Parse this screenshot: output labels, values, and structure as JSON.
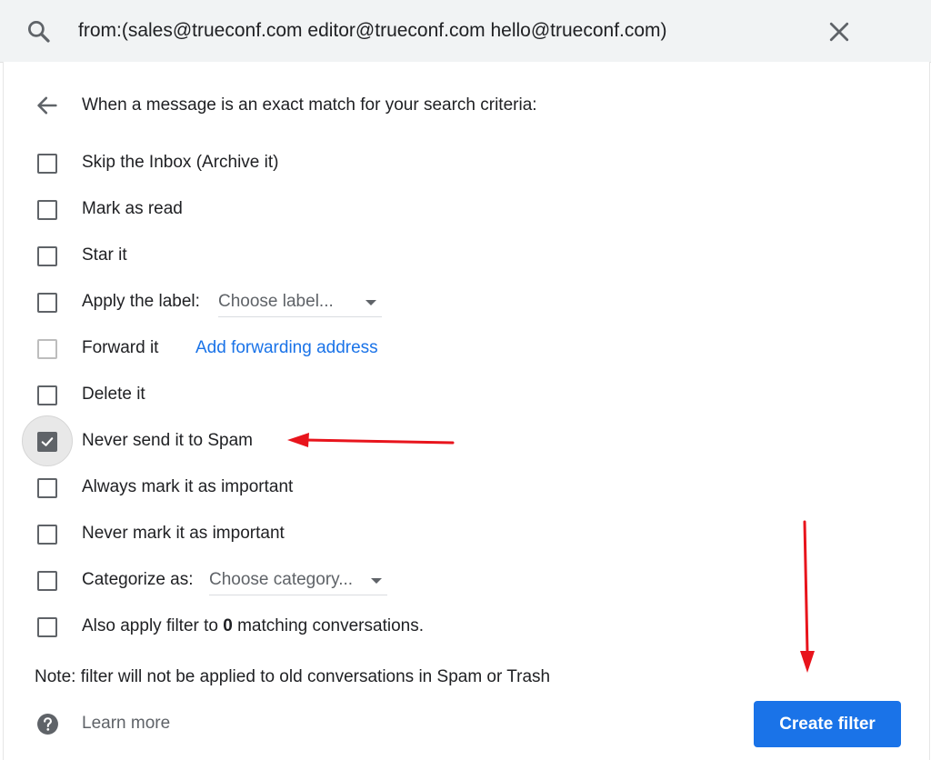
{
  "search": {
    "query": "from:(sales@trueconf.com editor@trueconf.com hello@trueconf.com)"
  },
  "header": {
    "text": "When a message is an exact match for your search criteria:"
  },
  "options": {
    "skip_inbox": {
      "label": "Skip the Inbox (Archive it)",
      "checked": false
    },
    "mark_read": {
      "label": "Mark as read",
      "checked": false
    },
    "star_it": {
      "label": "Star it",
      "checked": false
    },
    "apply_label": {
      "label": "Apply the label:",
      "dropdown": "Choose label...",
      "checked": false
    },
    "forward_it": {
      "label": "Forward it",
      "link": "Add forwarding address",
      "checked": false,
      "disabled": true
    },
    "delete_it": {
      "label": "Delete it",
      "checked": false
    },
    "never_spam": {
      "label": "Never send it to Spam",
      "checked": true
    },
    "always_important": {
      "label": "Always mark it as important",
      "checked": false
    },
    "never_important": {
      "label": "Never mark it as important",
      "checked": false
    },
    "categorize": {
      "label": "Categorize as:",
      "dropdown": "Choose category...",
      "checked": false
    },
    "also_apply": {
      "prefix": "Also apply filter to ",
      "count": "0",
      "suffix": " matching conversations.",
      "checked": false
    }
  },
  "note": "Note: filter will not be applied to old conversations in Spam or Trash",
  "footer": {
    "learn_more": "Learn more",
    "create_filter": "Create filter"
  },
  "colors": {
    "accent": "#1a73e8",
    "annotation_arrow": "#e8141c",
    "checkbox": "#5f6368"
  },
  "icons": [
    "search-icon",
    "close-icon",
    "back-arrow-icon",
    "checkmark-icon",
    "help-icon",
    "dropdown-caret-icon"
  ]
}
